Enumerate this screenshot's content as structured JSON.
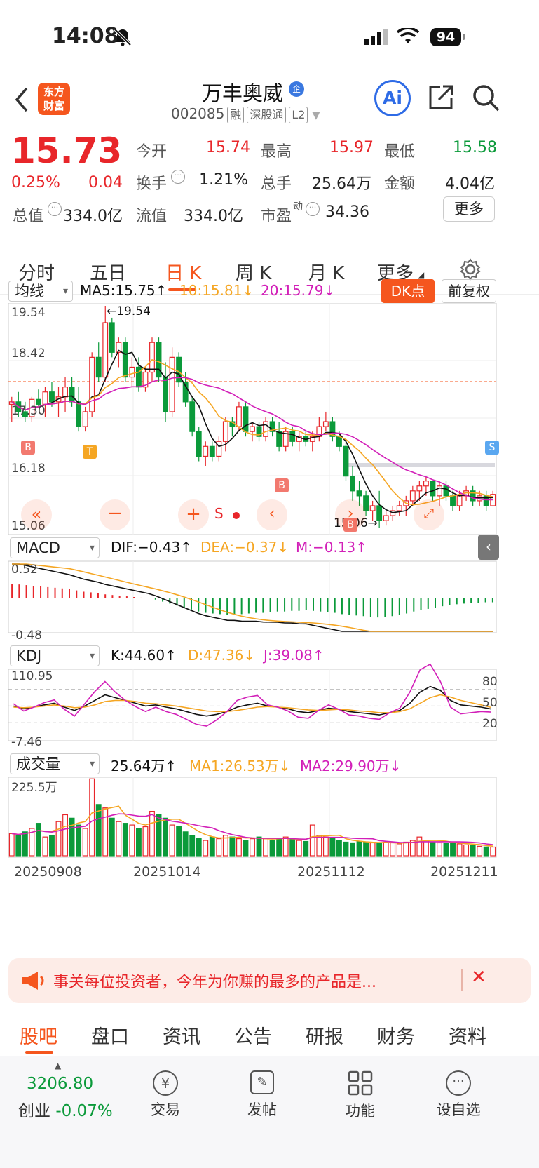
{
  "status": {
    "time": "14:08",
    "battery": "94"
  },
  "header": {
    "name": "万丰奥威",
    "badge": "企",
    "code": "002085",
    "chips": [
      "融",
      "深股通",
      "L2"
    ],
    "logo_line1": "东方",
    "logo_line2": "财富",
    "ai": "Ai"
  },
  "quote": {
    "price": "15.73",
    "pct": "0.25%",
    "chg": "0.04",
    "fields": [
      {
        "label": "今开",
        "value": "15.74",
        "color": "red"
      },
      {
        "label": "最高",
        "value": "15.97",
        "color": "red"
      },
      {
        "label": "最低",
        "value": "15.58",
        "color": "green"
      },
      {
        "label": "换手",
        "value": "1.21%",
        "color": "black"
      },
      {
        "label": "总手",
        "value": "25.64万",
        "color": "black"
      },
      {
        "label": "金额",
        "value": "4.04亿",
        "color": "black"
      },
      {
        "label": "总值",
        "value": "334.0亿",
        "color": "black"
      },
      {
        "label": "流值",
        "value": "334.0亿",
        "color": "black"
      },
      {
        "label": "市盈",
        "value": "34.36",
        "color": "black"
      }
    ],
    "pe_sup": "动",
    "more": "更多"
  },
  "tabs": [
    "分时",
    "五日",
    "日 K",
    "周 K",
    "月 K",
    "更多"
  ],
  "active_tab": 2,
  "kline": {
    "indicator": "均线",
    "ma5": "MA5:15.75↑",
    "ma10": "10:15.81↓",
    "ma20": "20:15.79↓",
    "dk": "DK点",
    "fq": "前复权",
    "axis": [
      "19.54",
      "18.42",
      "17.30",
      "16.18",
      "15.06"
    ],
    "high_label": "←19.54",
    "low_label": "15.06→",
    "signals": [
      "B",
      "T",
      "B",
      "S"
    ]
  },
  "macd": {
    "name": "MACD",
    "dif": "DIF:−0.43↑",
    "dea": "DEA:−0.37↓",
    "m": "M:−0.13↑",
    "top": "0.52",
    "bottom": "-0.48"
  },
  "kdj": {
    "name": "KDJ",
    "k": "K:44.60↑",
    "d": "D:47.36↓",
    "j": "J:39.08↑",
    "top": "110.95",
    "bottom": "-7.46",
    "levels": [
      "80",
      "50",
      "20"
    ]
  },
  "vol": {
    "name": "成交量",
    "v": "25.64万↑",
    "ma1": "MA1:26.53万↓",
    "ma2": "MA2:29.90万↓",
    "top": "225.5万"
  },
  "dates": [
    "20250908",
    "20251014",
    "20251112",
    "20251211"
  ],
  "chart_data": [
    {
      "type": "candlestick",
      "title": "日K",
      "ylim": [
        15.06,
        19.54
      ],
      "values": [
        [
          17.55,
          17.7,
          17.2,
          17.6
        ],
        [
          17.6,
          17.8,
          17.3,
          17.4
        ],
        [
          17.4,
          17.6,
          17.2,
          17.3
        ],
        [
          17.3,
          17.7,
          17.2,
          17.65
        ],
        [
          17.65,
          17.85,
          17.5,
          17.55
        ],
        [
          17.55,
          17.9,
          17.3,
          17.8
        ],
        [
          17.8,
          18.0,
          17.5,
          17.6
        ],
        [
          17.6,
          17.9,
          17.3,
          17.7
        ],
        [
          17.7,
          18.1,
          17.4,
          17.9
        ],
        [
          17.9,
          18.1,
          17.5,
          17.6
        ],
        [
          17.6,
          17.9,
          17.0,
          17.1
        ],
        [
          17.1,
          17.5,
          17.0,
          17.4
        ],
        [
          17.4,
          18.6,
          17.3,
          18.5
        ],
        [
          18.5,
          18.8,
          18.0,
          18.1
        ],
        [
          18.1,
          19.54,
          18.0,
          19.2
        ],
        [
          19.2,
          19.3,
          18.5,
          18.6
        ],
        [
          18.6,
          18.9,
          18.3,
          18.8
        ],
        [
          18.8,
          18.9,
          18.0,
          18.1
        ],
        [
          18.1,
          18.5,
          17.9,
          18.3
        ],
        [
          18.3,
          18.5,
          17.8,
          17.9
        ],
        [
          17.9,
          18.3,
          17.8,
          18.2
        ],
        [
          18.2,
          18.9,
          18.0,
          18.8
        ],
        [
          18.8,
          18.9,
          18.0,
          18.1
        ],
        [
          18.1,
          18.4,
          17.2,
          17.4
        ],
        [
          17.4,
          18.7,
          17.3,
          18.5
        ],
        [
          18.5,
          18.6,
          17.9,
          18.0
        ],
        [
          18.0,
          18.2,
          17.5,
          17.6
        ],
        [
          17.6,
          17.7,
          16.9,
          17.0
        ],
        [
          17.0,
          17.1,
          16.4,
          16.5
        ],
        [
          16.5,
          16.8,
          16.3,
          16.7
        ],
        [
          16.7,
          16.8,
          16.4,
          16.5
        ],
        [
          16.5,
          16.9,
          16.4,
          16.8
        ],
        [
          16.8,
          17.3,
          16.6,
          17.2
        ],
        [
          17.2,
          17.3,
          16.9,
          17.1
        ],
        [
          17.1,
          17.6,
          17.0,
          17.5
        ],
        [
          17.5,
          17.6,
          16.9,
          17.0
        ],
        [
          17.0,
          17.2,
          16.8,
          17.1
        ],
        [
          17.1,
          17.2,
          16.8,
          16.9
        ],
        [
          16.9,
          17.3,
          16.8,
          17.2
        ],
        [
          17.2,
          17.3,
          16.9,
          17.0
        ],
        [
          17.0,
          17.2,
          16.6,
          16.7
        ],
        [
          16.7,
          17.1,
          16.6,
          17.0
        ],
        [
          17.0,
          17.1,
          16.7,
          16.8
        ],
        [
          16.8,
          17.0,
          16.6,
          16.9
        ],
        [
          16.9,
          17.0,
          16.7,
          16.8
        ],
        [
          16.8,
          17.0,
          16.6,
          16.9
        ],
        [
          16.9,
          17.3,
          16.8,
          17.1
        ],
        [
          17.1,
          17.4,
          17.0,
          17.2
        ],
        [
          17.2,
          17.3,
          16.8,
          16.9
        ],
        [
          16.9,
          17.0,
          16.6,
          16.7
        ],
        [
          16.7,
          16.8,
          16.0,
          16.1
        ],
        [
          16.1,
          16.3,
          15.6,
          15.8
        ],
        [
          15.8,
          16.0,
          15.5,
          15.7
        ],
        [
          15.7,
          15.8,
          15.3,
          15.4
        ],
        [
          15.4,
          15.6,
          15.2,
          15.5
        ],
        [
          15.5,
          15.8,
          15.06,
          15.2
        ],
        [
          15.2,
          15.4,
          15.1,
          15.3
        ],
        [
          15.3,
          15.5,
          15.2,
          15.4
        ],
        [
          15.4,
          15.6,
          15.3,
          15.5
        ],
        [
          15.5,
          15.7,
          15.3,
          15.6
        ],
        [
          15.6,
          15.9,
          15.5,
          15.8
        ],
        [
          15.8,
          16.0,
          15.6,
          15.9
        ],
        [
          15.9,
          16.1,
          15.7,
          16.0
        ],
        [
          16.0,
          16.0,
          15.6,
          15.7
        ],
        [
          15.7,
          16.0,
          15.5,
          15.9
        ],
        [
          15.9,
          16.0,
          15.6,
          15.7
        ],
        [
          15.7,
          15.8,
          15.4,
          15.5
        ],
        [
          15.5,
          15.8,
          15.4,
          15.7
        ],
        [
          15.7,
          15.9,
          15.6,
          15.8
        ],
        [
          15.8,
          15.9,
          15.5,
          15.6
        ],
        [
          15.6,
          15.8,
          15.5,
          15.7
        ],
        [
          15.7,
          15.8,
          15.4,
          15.5
        ],
        [
          15.5,
          15.8,
          15.5,
          15.73
        ]
      ]
    },
    {
      "type": "bar",
      "title": "MACD",
      "ylim": [
        -0.48,
        0.52
      ],
      "values": [
        0.22,
        0.21,
        0.2,
        0.19,
        0.18,
        0.17,
        0.16,
        0.15,
        0.14,
        0.12,
        0.1,
        0.09,
        0.08,
        0.06,
        0.05,
        0.04,
        0.03,
        0.02,
        0.01,
        0.0,
        -0.02,
        -0.05,
        -0.08,
        -0.11,
        -0.14,
        -0.17,
        -0.2,
        -0.22,
        -0.23,
        -0.24,
        -0.25,
        -0.24,
        -0.24,
        -0.23,
        -0.22,
        -0.22,
        -0.21,
        -0.2,
        -0.2,
        -0.19,
        -0.19,
        -0.18,
        -0.19,
        -0.2,
        -0.21,
        -0.22,
        -0.24,
        -0.25,
        -0.26,
        -0.27,
        -0.28,
        -0.29,
        -0.28,
        -0.27,
        -0.25,
        -0.23,
        -0.2,
        -0.18,
        -0.16,
        -0.14,
        -0.12,
        -0.1,
        -0.09,
        -0.08,
        -0.07,
        -0.07,
        -0.06,
        -0.06
      ]
    },
    {
      "type": "line",
      "title": "KDJ",
      "ylim": [
        -7.46,
        110.95
      ],
      "series": [
        {
          "name": "K",
          "values": [
            50,
            45,
            48,
            52,
            55,
            48,
            42,
            50,
            60,
            70,
            65,
            60,
            55,
            50,
            52,
            48,
            45,
            40,
            35,
            32,
            35,
            40,
            48,
            52,
            55,
            50,
            48,
            45,
            40,
            38,
            42,
            46,
            44,
            40,
            38,
            36,
            34,
            38,
            42,
            55,
            75,
            85,
            78,
            60,
            52,
            50,
            48,
            44.6
          ]
        },
        {
          "name": "D",
          "values": [
            48,
            47,
            48,
            50,
            52,
            50,
            47,
            48,
            52,
            58,
            60,
            60,
            58,
            55,
            54,
            52,
            50,
            47,
            44,
            41,
            40,
            40,
            42,
            45,
            48,
            49,
            48,
            47,
            45,
            43,
            42,
            43,
            44,
            43,
            41,
            40,
            38,
            38,
            40,
            45,
            55,
            65,
            70,
            66,
            60,
            56,
            52,
            47.36
          ]
        },
        {
          "name": "J",
          "values": [
            54,
            41,
            48,
            56,
            61,
            44,
            32,
            54,
            76,
            94,
            75,
            60,
            49,
            40,
            48,
            40,
            35,
            26,
            17,
            14,
            25,
            40,
            60,
            66,
            69,
            52,
            48,
            41,
            30,
            28,
            42,
            52,
            44,
            34,
            32,
            28,
            26,
            38,
            46,
            75,
            115,
            125,
            94,
            48,
            36,
            38,
            40,
            39.08
          ]
        }
      ]
    },
    {
      "type": "bar",
      "title": "成交量",
      "ylim": [
        0,
        225.5
      ],
      "values": [
        65,
        60,
        70,
        80,
        95,
        55,
        60,
        100,
        120,
        110,
        90,
        80,
        225,
        150,
        140,
        110,
        100,
        95,
        90,
        80,
        85,
        130,
        120,
        110,
        90,
        85,
        70,
        60,
        50,
        45,
        55,
        50,
        60,
        55,
        50,
        45,
        50,
        55,
        50,
        45,
        50,
        55,
        48,
        45,
        42,
        90,
        60,
        55,
        50,
        45,
        40,
        38,
        42,
        40,
        38,
        36,
        40,
        38,
        35,
        40,
        45,
        55,
        45,
        40,
        38,
        36,
        38,
        35,
        32,
        30,
        28,
        26,
        25.64
      ]
    }
  ]
}
